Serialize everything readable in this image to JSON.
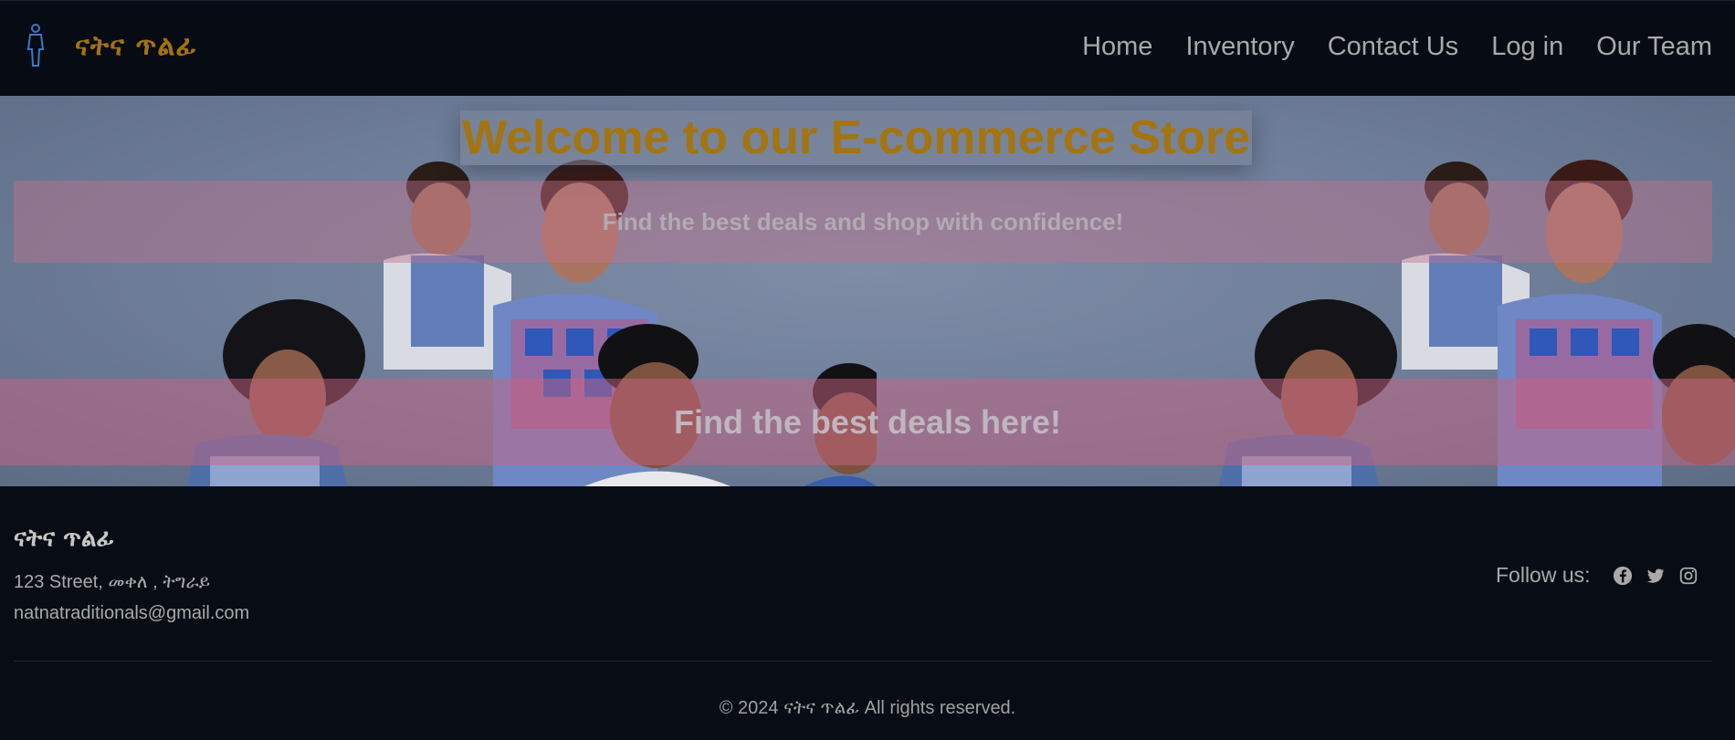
{
  "header": {
    "brand_name": "ናትና ጥልፊ",
    "brand_icon": "person-icon",
    "nav": [
      "Home",
      "Inventory",
      "Contact Us",
      "Log in",
      "Our Team"
    ]
  },
  "hero": {
    "title": "Welcome to our E-commerce Store",
    "subtitle": "Find the best deals and shop with confidence!",
    "banner": "Find the best deals here!"
  },
  "footer": {
    "name": "ናትና ጥልፊ",
    "address": "123 Street, መቀለ , ትግራይ",
    "email": "natnatraditionals@gmail.com",
    "follow_label": "Follow us:",
    "social": [
      "facebook-icon",
      "twitter-icon",
      "instagram-icon"
    ],
    "copyright": "© 2024 ናትና ጥልፊ All rights reserved."
  },
  "colors": {
    "accent": "#a37410",
    "background": "#080c15",
    "hero_overlay": "#6d7c97"
  }
}
